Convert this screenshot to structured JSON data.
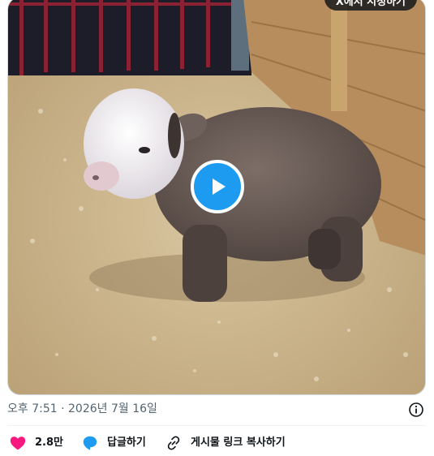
{
  "media": {
    "badge_text": "X에서 시청하기",
    "play_icon": "play-icon"
  },
  "meta": {
    "time": "오후 7:51",
    "separator": "·",
    "date": "2026년 7월 16일",
    "info_icon": "info-icon"
  },
  "actions": {
    "like": {
      "icon": "heart-icon",
      "count": "2.8만",
      "color": "#f91880"
    },
    "reply": {
      "icon": "speech-bubble-icon",
      "label": "답글하기",
      "color": "#1d9bf0"
    },
    "copy_link": {
      "icon": "link-icon",
      "label": "게시물 링크 복사하기"
    }
  },
  "colors": {
    "accent": "#1d9bf0",
    "secondary_text": "#536471",
    "like": "#f91880"
  }
}
